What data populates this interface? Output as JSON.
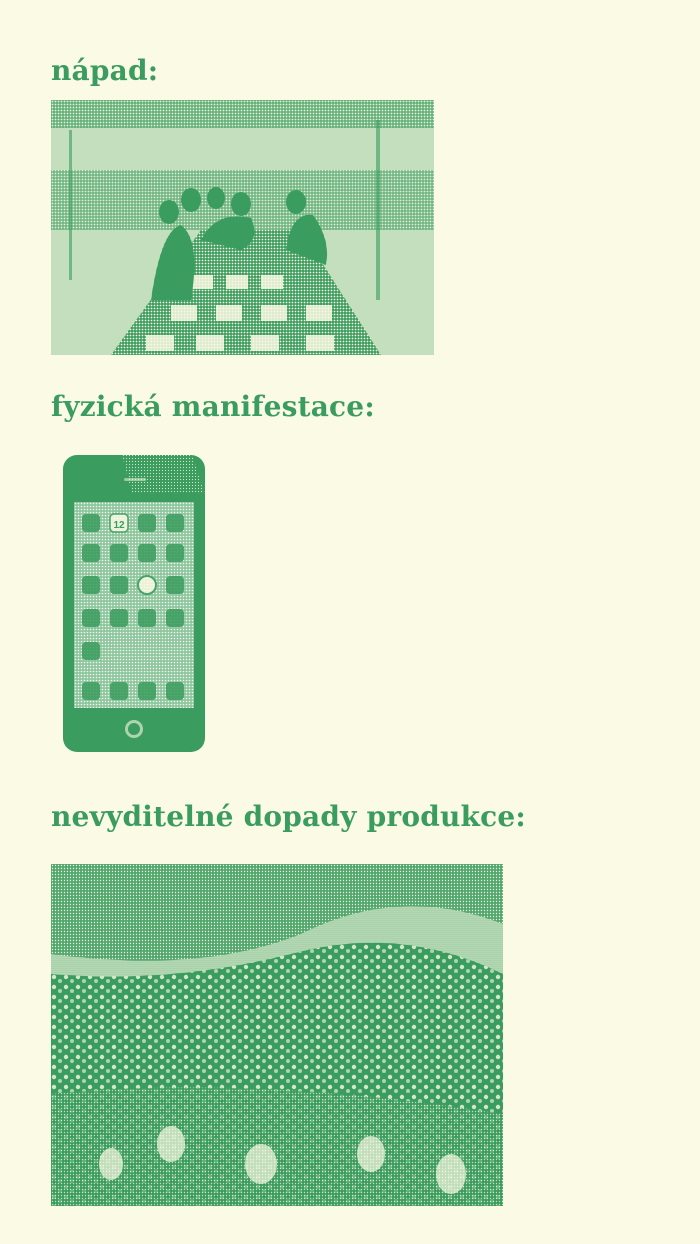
{
  "sections": [
    {
      "heading": "nápad:",
      "image": "meeting-table-photo"
    },
    {
      "heading": "fyzická manifestace:",
      "image": "smartphone-photo"
    },
    {
      "heading": "nevyditelné dopady produkce:",
      "image": "mining-crowd-photo"
    }
  ],
  "phone": {
    "calendar_day": "12"
  },
  "colors": {
    "background": "#fbfae4",
    "accent": "#3a9c5e"
  }
}
